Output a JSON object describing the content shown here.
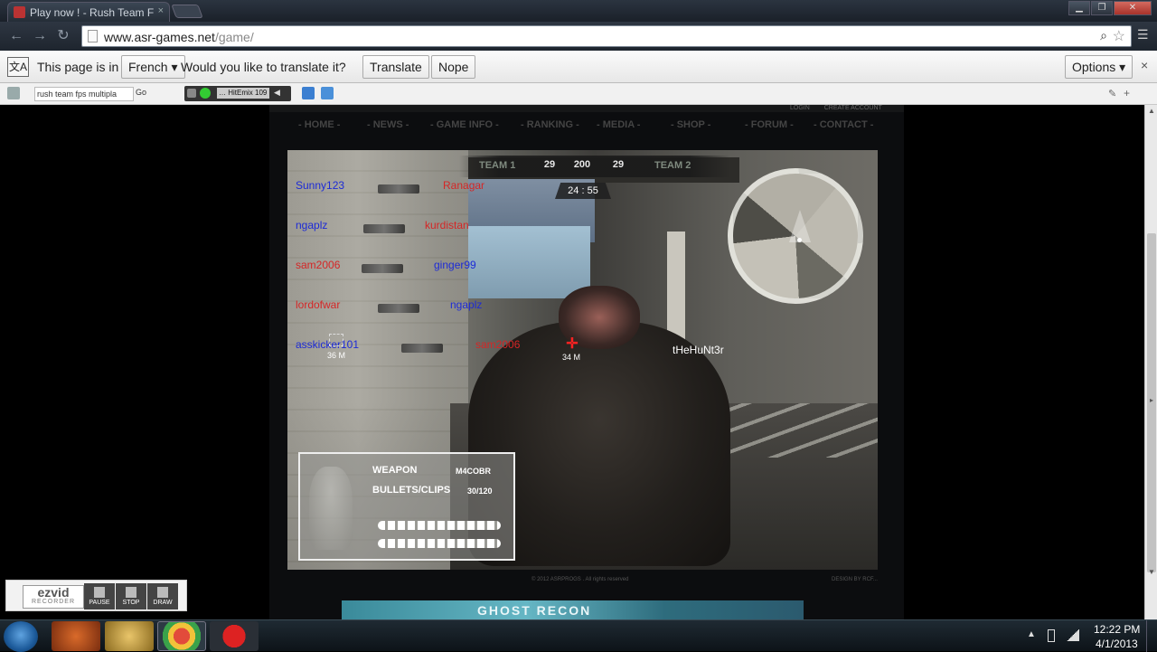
{
  "browser": {
    "tab_title": "Play now ! - Rush Team F",
    "tab_close": "×",
    "url_host": "www.asr-games.net",
    "url_path": "/game/",
    "window_min": "▁",
    "window_max": "❐",
    "window_close": "✕"
  },
  "translate_bar": {
    "intro": "This page is in",
    "language": "French ▾",
    "question": "Would you like to translate it?",
    "translate_label": "Translate",
    "nope_label": "Nope",
    "options_label": "Options ▾",
    "close": "×"
  },
  "toolbar": {
    "search_text": "rush team fps multipla",
    "go_label": "Go",
    "player_track": "… HitEmix 109",
    "player_vol": "◀"
  },
  "site": {
    "account_links": [
      "LOGIN",
      "CREATE ACCOUNT"
    ],
    "nav": [
      "- HOME -",
      "- NEWS -",
      "- GAME INFO -",
      "- RANKING -",
      "- MEDIA -",
      "- SHOP -",
      "- FORUM -",
      "- CONTACT -"
    ],
    "footer_copy": "© 2012 ASRPROGS . All rights reserved",
    "footer_design": "DESIGN BY RCF..."
  },
  "game": {
    "team1_label": "TEAM 1",
    "team1_score": "29",
    "score_limit": "200",
    "team2_score": "29",
    "team2_label": "TEAM 2",
    "timer": "24 : 55",
    "kill_feed": [
      {
        "killer": "Sunny123",
        "victim": "Ranagar",
        "killer_team": "blue",
        "victim_team": "red"
      },
      {
        "killer": "ngaplz",
        "victim": "kurdistan",
        "killer_team": "blue",
        "victim_team": "red"
      },
      {
        "killer": "sam2006",
        "victim": "ginger99",
        "killer_team": "red",
        "victim_team": "blue"
      },
      {
        "killer": "lordofwar",
        "victim": "ngaplz",
        "killer_team": "red",
        "victim_team": "blue"
      },
      {
        "killer": "asskicker101",
        "victim": "sam2006",
        "killer_team": "blue",
        "victim_team": "red"
      }
    ],
    "player_name": "tHeHuNt3r",
    "distance_left": "36 M",
    "distance_center": "34 M",
    "crosshair": "✛",
    "weapon_label": "WEAPON",
    "weapon_name": "M4COBR",
    "bullets_label": "BULLETS/CLIPS",
    "bullets_value": "30/120"
  },
  "ad": {
    "text": "GHOST RECON"
  },
  "ezvid": {
    "logo": "ezvid",
    "logo_sub": "RECORDER",
    "pause": "PAUSE",
    "stop": "STOP",
    "draw": "DRAW"
  },
  "taskbar": {
    "time": "12:22 PM",
    "date": "4/1/2013",
    "tray_up": "▲"
  },
  "colors": {
    "team_blue": "#1d2bd6",
    "team_red": "#d52626",
    "crosshair": "#ff2222"
  }
}
